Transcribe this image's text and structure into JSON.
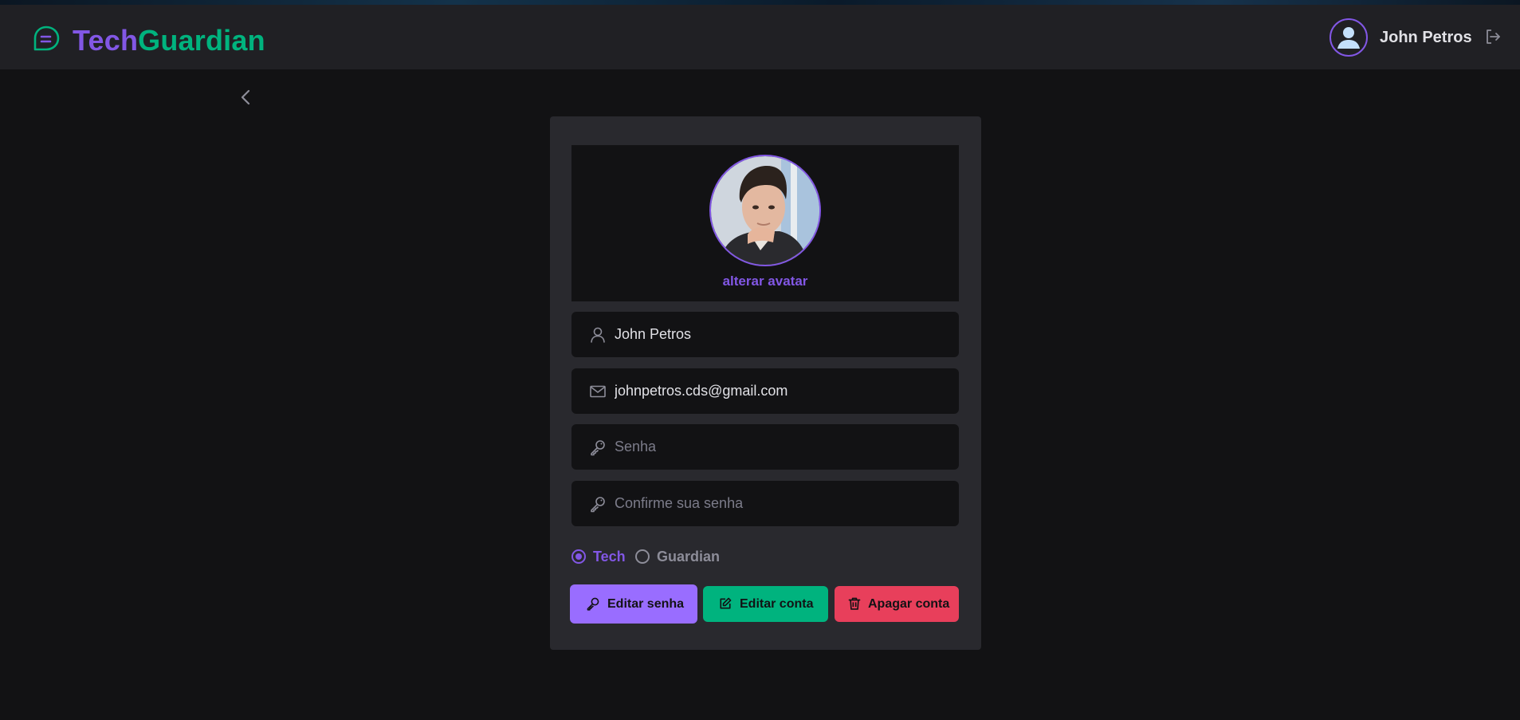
{
  "header": {
    "logo_part1": "Tech",
    "logo_part2": "Guardian",
    "user_name": "John Petros"
  },
  "profile": {
    "change_avatar_label": "alterar avatar",
    "name_value": "John Petros",
    "email_value": "johnpetros.cds@gmail.com",
    "password_placeholder": "Senha",
    "confirm_password_placeholder": "Confirme sua senha",
    "role_options": [
      {
        "label": "Tech",
        "selected": true
      },
      {
        "label": "Guardian",
        "selected": false
      }
    ]
  },
  "actions": {
    "edit_password": "Editar senha",
    "edit_account": "Editar conta",
    "delete_account": "Apagar conta"
  },
  "icons": {
    "logo": "chat-bubble-icon",
    "user": "user-icon",
    "email": "mail-icon",
    "password": "key-icon",
    "logout": "logout-icon",
    "back": "chevron-left-icon",
    "edit": "edit-icon",
    "delete": "trash-icon"
  },
  "colors": {
    "background": "#121214",
    "header": "#202024",
    "card": "#29292e",
    "purple": "#8257e5",
    "purple_button": "#996dff",
    "green": "#00b37e",
    "red": "#e83f5b"
  }
}
